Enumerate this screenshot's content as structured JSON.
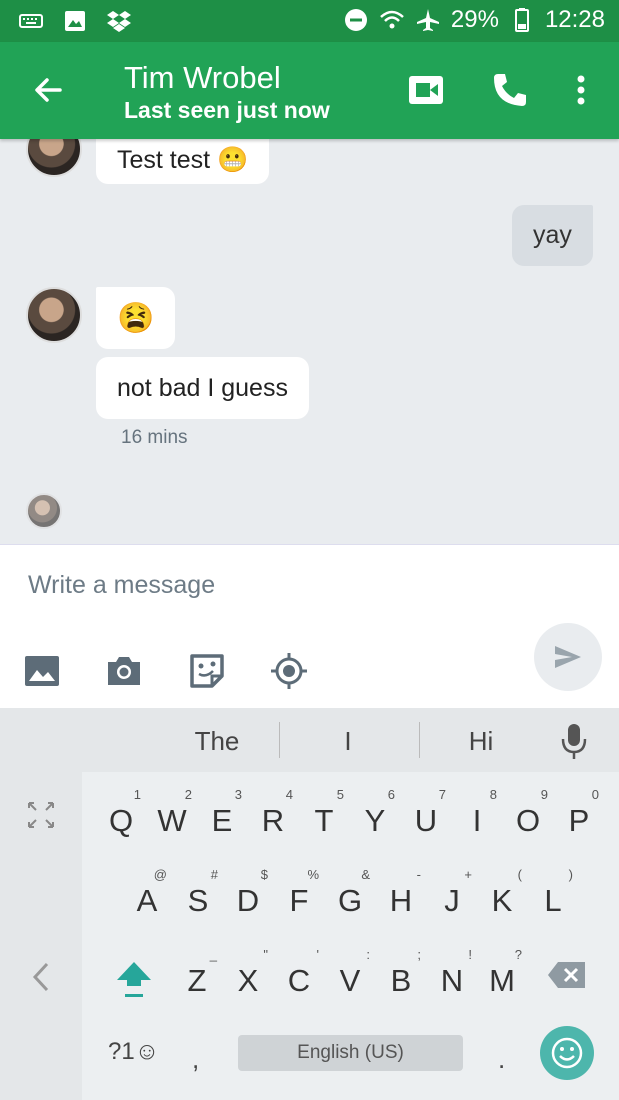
{
  "status_bar": {
    "battery": "29%",
    "time": "12:28",
    "icons": [
      "keyboard-icon",
      "image-icon",
      "dropbox-icon",
      "do-not-disturb-icon",
      "wifi-icon",
      "airplane-icon",
      "battery-icon"
    ]
  },
  "app_bar": {
    "title": "Tim Wrobel",
    "subtitle": "Last seen just now",
    "icons": [
      "back-arrow-icon",
      "video-call-icon",
      "phone-icon",
      "more-options-icon"
    ]
  },
  "messages": [
    {
      "direction": "in",
      "text": "Test test 😬"
    },
    {
      "direction": "out",
      "text": "yay"
    },
    {
      "direction": "in",
      "text": "😫"
    },
    {
      "direction": "in",
      "text": "not bad I guess"
    }
  ],
  "timestamp": "16 mins",
  "composer": {
    "placeholder": "Write a message",
    "icons": [
      "gallery-icon",
      "camera-icon",
      "sticker-icon",
      "location-icon",
      "send-icon"
    ]
  },
  "keyboard": {
    "suggestions": [
      "The",
      "I",
      "Hi"
    ],
    "row1": [
      [
        "Q",
        "1"
      ],
      [
        "W",
        "2"
      ],
      [
        "E",
        "3"
      ],
      [
        "R",
        "4"
      ],
      [
        "T",
        "5"
      ],
      [
        "Y",
        "6"
      ],
      [
        "U",
        "7"
      ],
      [
        "I",
        "8"
      ],
      [
        "O",
        "9"
      ],
      [
        "P",
        "0"
      ]
    ],
    "row2": [
      [
        "A",
        "@"
      ],
      [
        "S",
        "#"
      ],
      [
        "D",
        "$"
      ],
      [
        "F",
        "%"
      ],
      [
        "G",
        "&"
      ],
      [
        "H",
        "-"
      ],
      [
        "J",
        "+"
      ],
      [
        "K",
        "("
      ],
      [
        "L",
        ")"
      ]
    ],
    "row3": [
      [
        "Z",
        "_"
      ],
      [
        "X",
        "\""
      ],
      [
        "C",
        "'"
      ],
      [
        "V",
        ":"
      ],
      [
        "B",
        ";"
      ],
      [
        "N",
        "!"
      ],
      [
        "M",
        "?"
      ]
    ],
    "symbols_label": "?1☺",
    "comma": ",",
    "space_label": "English (US)",
    "period": "."
  },
  "colors": {
    "status_bar": "#1e8f46",
    "app_bar": "#21a356",
    "chat_bg": "#e9ecef",
    "emoji_key": "#4db6ac",
    "shift_accent": "#26a69a"
  }
}
